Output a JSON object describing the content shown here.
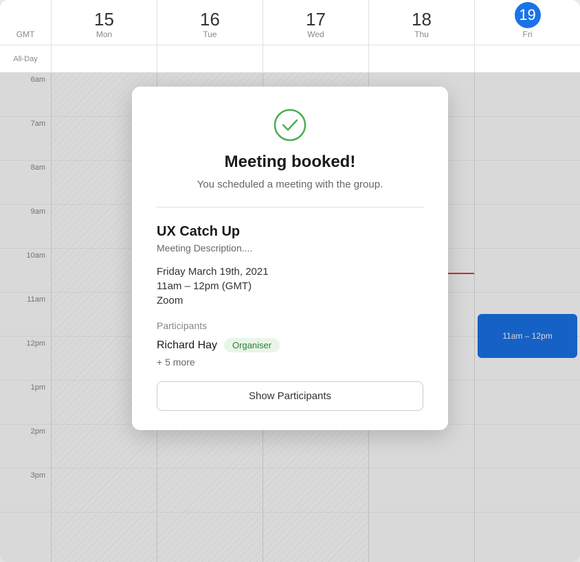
{
  "header": {
    "gmt_label": "GMT",
    "days": [
      {
        "number": "15",
        "name": "Mon",
        "today": false
      },
      {
        "number": "16",
        "name": "Tue",
        "today": false
      },
      {
        "number": "17",
        "name": "Wed",
        "today": false
      },
      {
        "number": "18",
        "name": "Thu",
        "today": false
      },
      {
        "number": "19",
        "name": "Fri",
        "today": true
      }
    ]
  },
  "allday_label": "All-Day",
  "time_slots": [
    "6am",
    "7am",
    "8am",
    "9am",
    "10am",
    "11am",
    "12pm",
    "1pm",
    "2pm",
    "3pm"
  ],
  "event": {
    "label": "11am – 12pm"
  },
  "modal": {
    "success_title": "Meeting booked!",
    "success_subtitle": "You scheduled a meeting with the group.",
    "meeting_title": "UX Catch Up",
    "meeting_description": "Meeting Description....",
    "meeting_date": "Friday March 19th, 2021",
    "meeting_time": "11am – 12pm (GMT)",
    "meeting_location": "Zoom",
    "participants_label": "Participants",
    "organiser_name": "Richard Hay",
    "organiser_badge": "Organiser",
    "more_label": "+ 5 more",
    "show_participants_btn": "Show Participants"
  }
}
